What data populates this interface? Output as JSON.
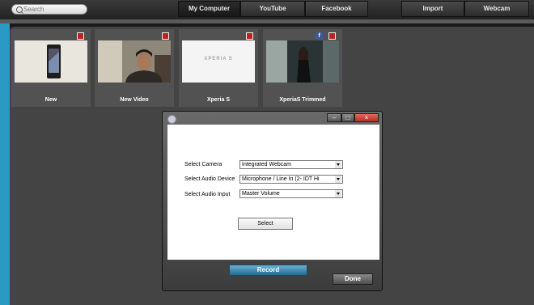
{
  "search": {
    "placeholder": "Search"
  },
  "tabs": [
    {
      "label": "My Computer",
      "active": true
    },
    {
      "label": "YouTube",
      "active": false
    },
    {
      "label": "Facebook",
      "active": false
    },
    {
      "label": "Import",
      "active": false
    },
    {
      "label": "Webcam",
      "active": false
    }
  ],
  "videos": [
    {
      "title": "New",
      "badges": [
        "youtube-icon"
      ]
    },
    {
      "title": "New Video",
      "badges": [
        "youtube-icon"
      ]
    },
    {
      "title": "Xperia S",
      "badges": [
        "youtube-icon"
      ],
      "thumb_text": "XPERIA S"
    },
    {
      "title": "XperiaS Trimmed",
      "badges": [
        "facebook-icon",
        "youtube-icon"
      ]
    }
  ],
  "dialog": {
    "fields": [
      {
        "label": "Select Camera",
        "value": "Integrated Webcam"
      },
      {
        "label": "Select Audio Device",
        "value": "Microphone / Line In (2- IDT Hi"
      },
      {
        "label": "Select Audio Input",
        "value": "Master Volume"
      }
    ],
    "select_button": "Select",
    "record_button": "Record",
    "done_button": "Done",
    "window_buttons": [
      "minimize",
      "maximize",
      "close"
    ]
  },
  "colors": {
    "accent": "#2a9ac4",
    "record": "#3f8fb6",
    "close": "#c9473a"
  }
}
